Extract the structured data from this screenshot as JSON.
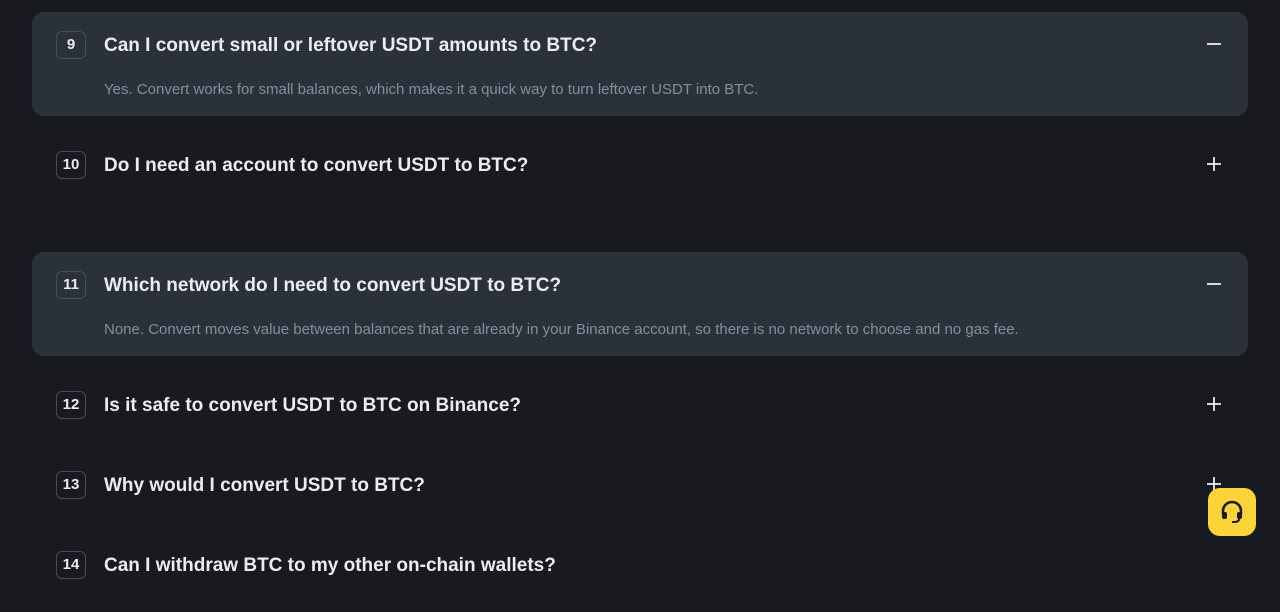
{
  "faq": {
    "items": [
      {
        "number": "9",
        "question": "Can I convert small or leftover USDT amounts to BTC?",
        "answer": "Yes. Convert works for small balances, which makes it a quick way to turn leftover USDT into BTC.",
        "expanded": true,
        "toggle_icon": "minus-icon"
      },
      {
        "number": "10",
        "question": "Do I need an account to convert USDT to BTC?",
        "expanded": false,
        "toggle_icon": "plus-icon"
      },
      {
        "number": "11",
        "question": "Which network do I need to convert USDT to BTC?",
        "answer": "None. Convert moves value between balances that are already in your Binance account, so there is no network to choose and no gas fee.",
        "expanded": true,
        "toggle_icon": "minus-icon"
      },
      {
        "number": "12",
        "question": "Is it safe to convert USDT to BTC on Binance?",
        "expanded": false,
        "toggle_icon": "plus-icon"
      },
      {
        "number": "13",
        "question": "Why would I convert USDT to BTC?",
        "expanded": false,
        "toggle_icon": "plus-icon"
      },
      {
        "number": "14",
        "question": "Can I withdraw BTC to my other on-chain wallets?",
        "expanded": false,
        "toggle_icon": "plus-icon"
      }
    ]
  },
  "support": {
    "icon": "headset-icon"
  },
  "colors": {
    "background": "#181a20",
    "card": "#2b3139",
    "text_primary": "#eaecef",
    "text_secondary": "#848e9c",
    "accent": "#fcd535"
  }
}
